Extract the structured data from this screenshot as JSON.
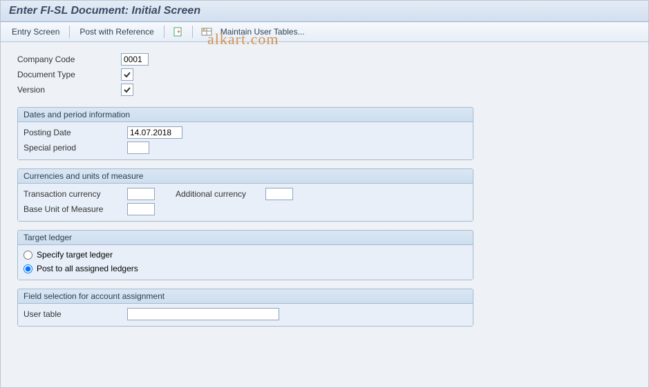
{
  "title": "Enter FI-SL Document: Initial Screen",
  "toolbar": {
    "entry_screen": "Entry Screen",
    "post_with_reference": "Post with Reference",
    "maintain_user_tables": "Maintain User Tables..."
  },
  "fields": {
    "company_code_label": "Company Code",
    "company_code_value": "0001",
    "document_type_label": "Document Type",
    "version_label": "Version"
  },
  "group_dates": {
    "title": "Dates and period information",
    "posting_date_label": "Posting Date",
    "posting_date_value": "14.07.2018",
    "special_period_label": "Special period",
    "special_period_value": ""
  },
  "group_currencies": {
    "title": "Currencies and units of measure",
    "transaction_currency_label": "Transaction currency",
    "transaction_currency_value": "",
    "additional_currency_label": "Additional currency",
    "additional_currency_value": "",
    "base_uom_label": "Base Unit of Measure",
    "base_uom_value": ""
  },
  "group_target_ledger": {
    "title": "Target ledger",
    "radio_specify_label": "Specify target ledger",
    "radio_post_all_label": "Post to all assigned ledgers",
    "selected": "post_all"
  },
  "group_field_selection": {
    "title": "Field selection for account assignment",
    "user_table_label": "User table",
    "user_table_value": ""
  },
  "watermark": "alkart.com"
}
